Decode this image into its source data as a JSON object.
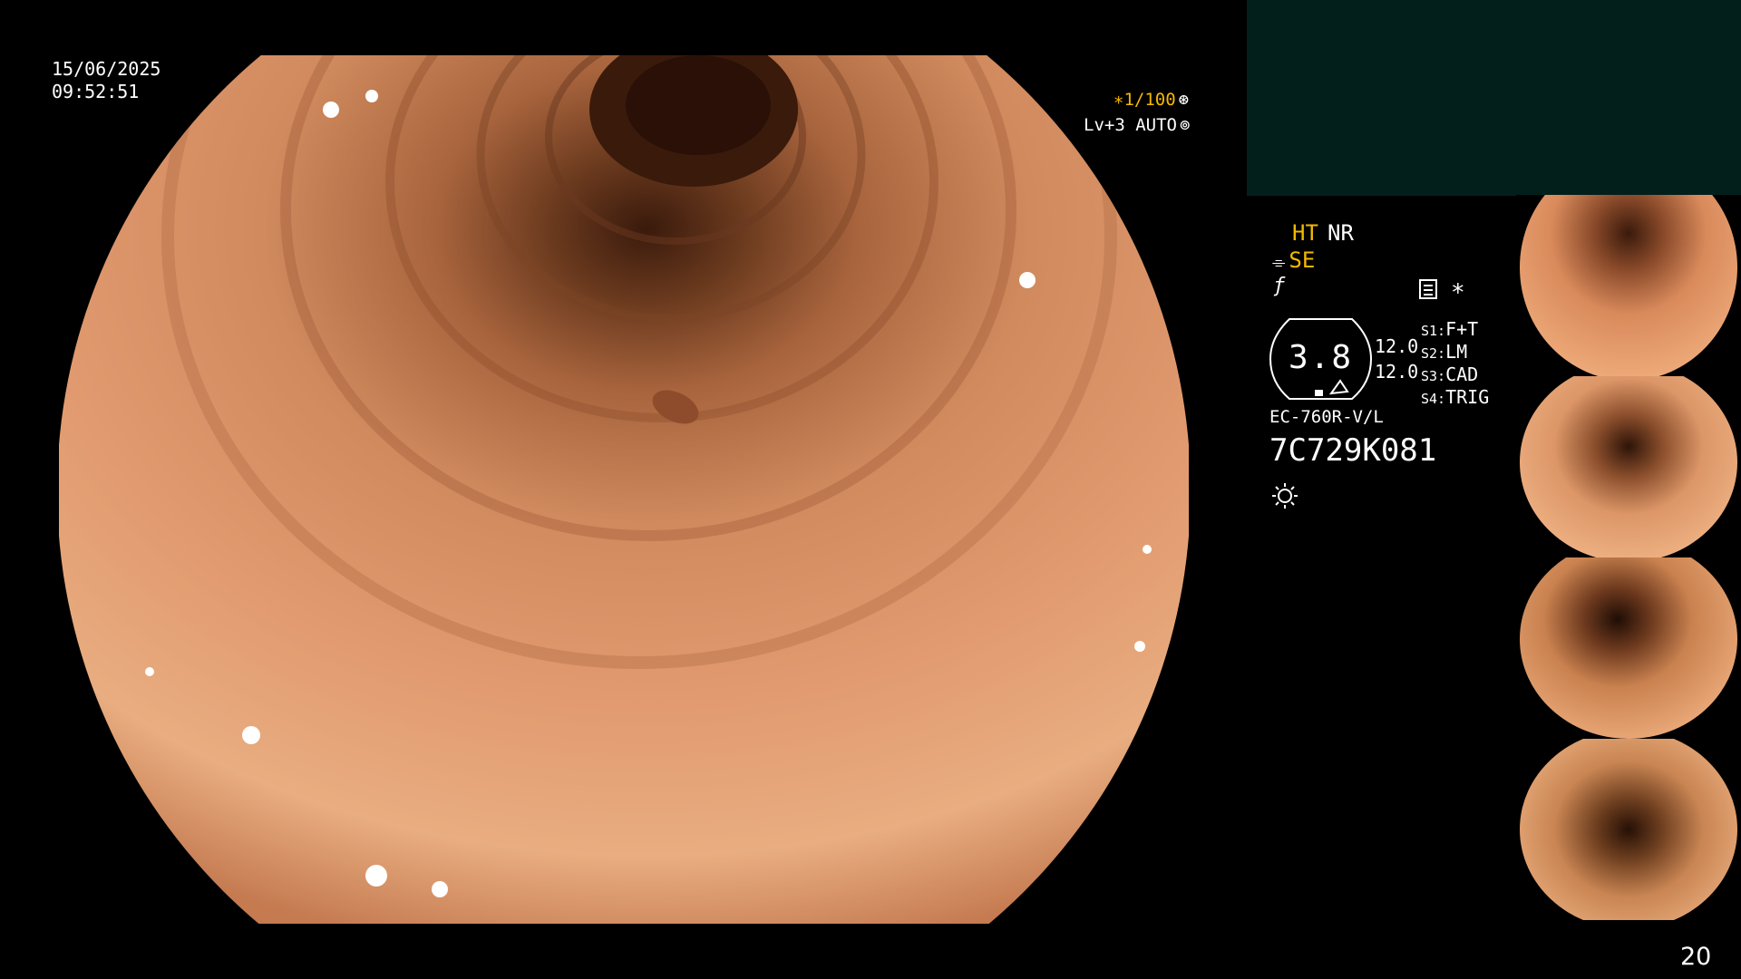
{
  "overlay": {
    "date": "15/06/2025",
    "time": "09:52:51",
    "shutter": "∗1/100",
    "shutter_icon": "aperture-icon",
    "level": "Lv+3 AUTO",
    "level_icon": "iris-icon"
  },
  "status": {
    "ht": "HT",
    "nr": "NR",
    "se": "SE",
    "asterisk": "∗",
    "gauge_value": "3.8",
    "value_1": "12.0",
    "value_2": "12.0",
    "slots": [
      {
        "key": "S1:",
        "value": "F+T"
      },
      {
        "key": "S2:",
        "value": "LM"
      },
      {
        "key": "S3:",
        "value": "CAD"
      },
      {
        "key": "S4:",
        "value": "TRIG"
      }
    ],
    "scope_model": "EC-760R-V/L",
    "serial": "7C729K081"
  },
  "thumbnails": [
    {
      "name": "capture-1"
    },
    {
      "name": "capture-2"
    },
    {
      "name": "capture-3"
    },
    {
      "name": "capture-4"
    }
  ],
  "page_number": "20",
  "colors": {
    "accent": "#f5b800",
    "panel": "#021f1c",
    "tissue_light": "#f1b98a",
    "tissue_mid": "#d9885a",
    "tissue_dark": "#4a2414",
    "background": "#000000"
  }
}
